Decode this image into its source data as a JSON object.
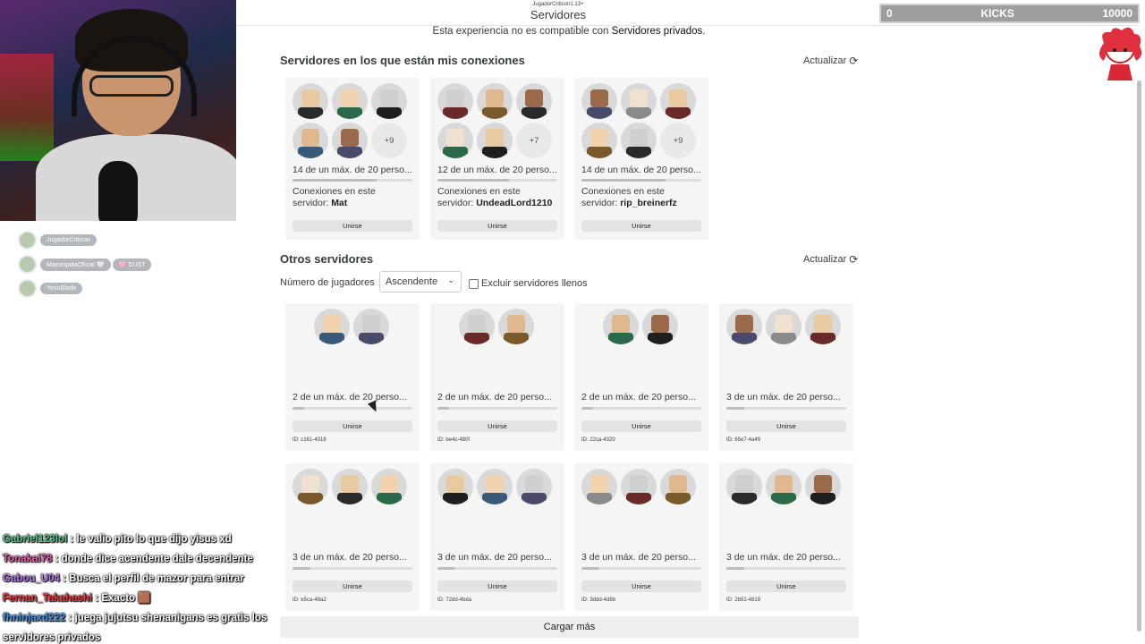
{
  "stream": {
    "viewers": [
      {
        "name": "JugadorCriticon"
      },
      {
        "name": "MazorquitaOficial 🤍",
        "badge": "🩷 DUST"
      },
      {
        "name": "YesoBlade"
      }
    ],
    "chat": [
      {
        "user": "Gabriel123lol",
        "text": "le valio pito lo que dijo yisus xd",
        "color": "#5ec08a"
      },
      {
        "user": "Tonakai78",
        "text": "donde dice acendente dale decendente",
        "color": "#e060a8"
      },
      {
        "user": "Gabou_U04",
        "text": "Busca el perfil de mazor para entrar",
        "color": "#b07ee0"
      },
      {
        "user": "Fernan_Takahashi",
        "text": "Exacto 🟫",
        "color": "#e04040"
      },
      {
        "user": "fhninjaxd222",
        "text": "juega jujutsu shenanigans es gratis los servidores privados",
        "color": "#4a90e0"
      }
    ],
    "kicks": {
      "min": "0",
      "label": "KICKS",
      "max": "10000",
      "progress": 0
    }
  },
  "header": {
    "subtitle": "JugadorCriticon1:13+",
    "title": "Servidores"
  },
  "notice": {
    "prefix": "Esta experiencia no es compatible con ",
    "highlight": "Servidores privados",
    "suffix": "."
  },
  "friends_section": {
    "title": "Servidores en los que están mis conexiones",
    "refresh_label": "Actualizar",
    "refresh_icon": "refresh-icon",
    "servers": [
      {
        "avatars": 5,
        "more": "+9",
        "caption": "14 de un máx. de 20 perso...",
        "fill": 0.7,
        "conn_label": "Conexiones en este servidor:",
        "conn_name": "Mat",
        "join_label": "Unirse"
      },
      {
        "avatars": 5,
        "more": "+7",
        "caption": "12 de un máx. de 20 perso...",
        "fill": 0.6,
        "conn_label": "Conexiones en este servidor:",
        "conn_name": "UndeadLord1210",
        "join_label": "Unirse"
      },
      {
        "avatars": 5,
        "more": "+9",
        "caption": "14 de un máx. de 20 perso...",
        "fill": 0.7,
        "conn_label": "Conexiones en este servidor:",
        "conn_name": "rip_breinerfz",
        "join_label": "Unirse"
      }
    ]
  },
  "other_section": {
    "title": "Otros servidores",
    "refresh_label": "Actualizar",
    "filter_label": "Número de jugadores",
    "sort_value": "Ascendente",
    "exclude_label": "Excluir servidores llenos",
    "servers": [
      {
        "avatars": 2,
        "caption": "2 de un máx. de 20 perso...",
        "fill": 0.1,
        "join_label": "Unirse",
        "id": "ID: c161-4318"
      },
      {
        "avatars": 2,
        "caption": "2 de un máx. de 20 perso...",
        "fill": 0.1,
        "join_label": "Unirse",
        "id": "ID: be4c-480f"
      },
      {
        "avatars": 2,
        "caption": "2 de un máx. de 20 perso...",
        "fill": 0.1,
        "join_label": "Unirse",
        "id": "ID: 22ca-4320"
      },
      {
        "avatars": 3,
        "caption": "3 de un máx. de 20 perso...",
        "fill": 0.15,
        "join_label": "Unirse",
        "id": "ID: 65e7-4a49"
      },
      {
        "avatars": 3,
        "caption": "3 de un máx. de 20 perso...",
        "fill": 0.15,
        "join_label": "Unirse",
        "id": "ID: e5ca-48a2"
      },
      {
        "avatars": 3,
        "caption": "3 de un máx. de 20 perso...",
        "fill": 0.15,
        "join_label": "Unirse",
        "id": "ID: 72dd-4bda"
      },
      {
        "avatars": 3,
        "caption": "3 de un máx. de 20 perso...",
        "fill": 0.15,
        "join_label": "Unirse",
        "id": "ID: 3ddd-4d8b"
      },
      {
        "avatars": 3,
        "caption": "3 de un máx. de 20 perso...",
        "fill": 0.15,
        "join_label": "Unirse",
        "id": "ID: 2b51-4819"
      }
    ],
    "load_more_label": "Cargar más"
  }
}
